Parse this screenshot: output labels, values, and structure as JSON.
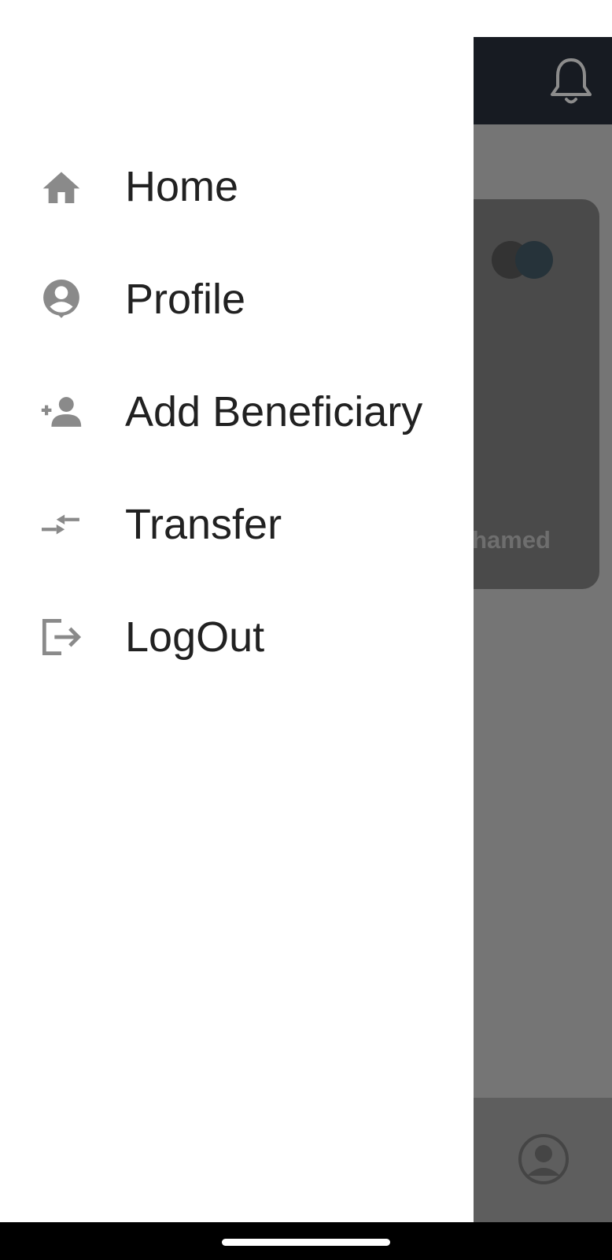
{
  "drawer": {
    "items": [
      {
        "label": "Home",
        "icon": "home-icon"
      },
      {
        "label": "Profile",
        "icon": "profile-icon"
      },
      {
        "label": "Add Beneficiary",
        "icon": "add-person-icon"
      },
      {
        "label": "Transfer",
        "icon": "transfer-arrows-icon"
      },
      {
        "label": "LogOut",
        "icon": "logout-icon"
      }
    ]
  },
  "background": {
    "card_holder_partial": "hamed",
    "appbar_icon": "bell-icon",
    "bottom_nav_icon": "account-circle-icon"
  },
  "colors": {
    "drawer_bg": "#ffffff",
    "icon_gray": "#8a8a8a",
    "label_text": "#212121",
    "appbar_dark": "#171b22",
    "scrim": "#757575"
  }
}
